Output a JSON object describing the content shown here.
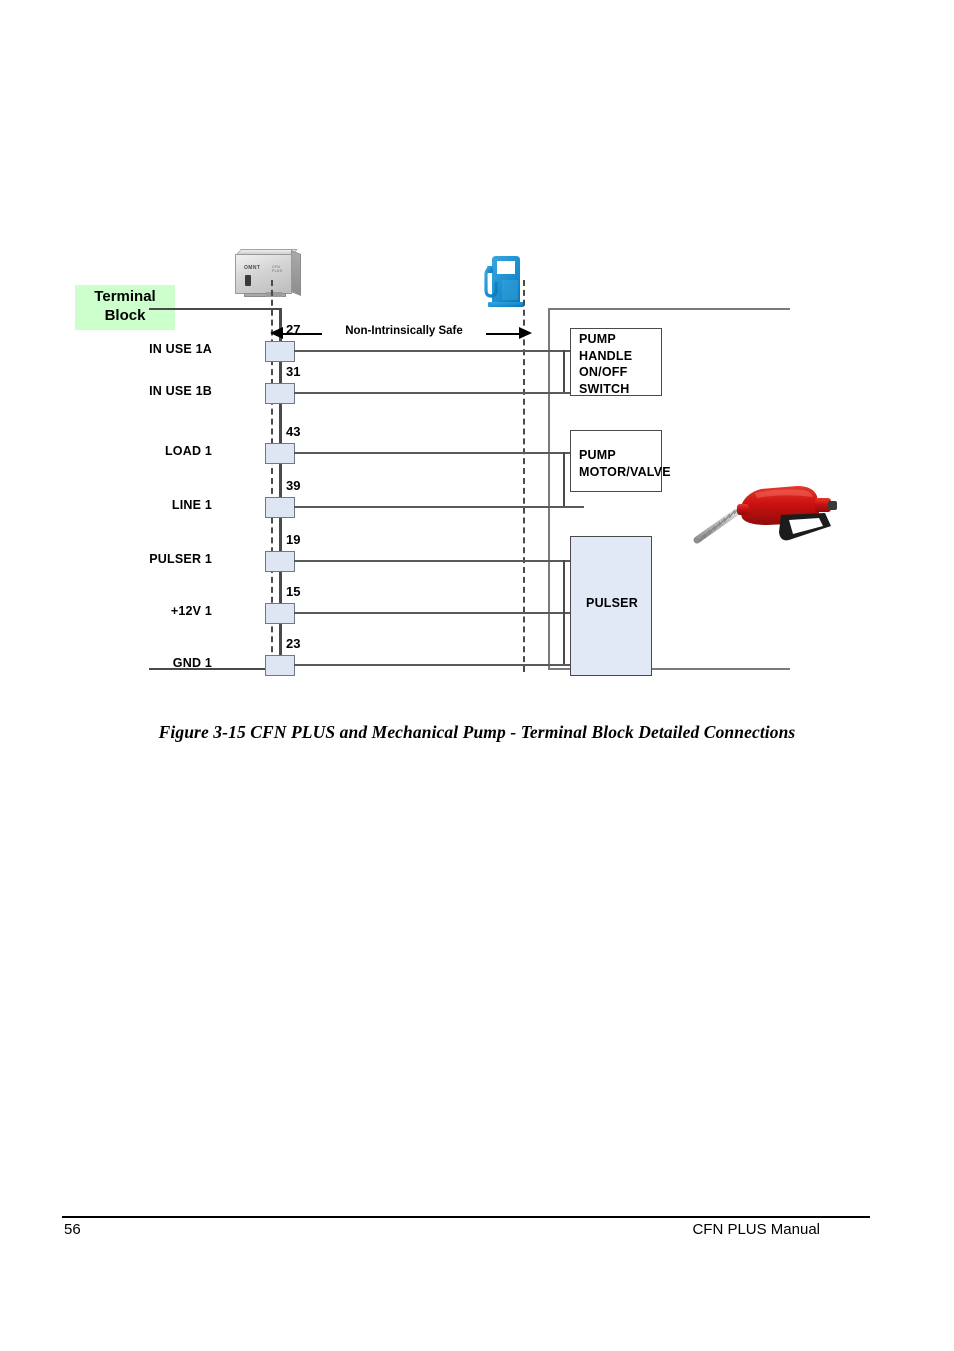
{
  "page": {
    "footer_page_number": "56",
    "footer_title": "CFN PLUS Manual"
  },
  "figure": {
    "caption": "Figure 3-15  CFN PLUS and Mechanical Pump - Terminal Block Detailed Connections",
    "terminal_block": {
      "label_line1": "Terminal",
      "label_line2": "Block",
      "highlight_color": "#ccffcc"
    },
    "zone_label": {
      "text": "Non-Intrinsically Safe",
      "arrow": "double-headed"
    },
    "terminals": [
      {
        "label": "IN USE 1A",
        "number": "27"
      },
      {
        "label": "IN USE 1B",
        "number": "31"
      },
      {
        "label": "LOAD 1",
        "number": "43"
      },
      {
        "label": "LINE 1",
        "number": "39"
      },
      {
        "label": "PULSER 1",
        "number": "19"
      },
      {
        "label": "+12V 1",
        "number": "15"
      },
      {
        "label": "GND 1",
        "number": "23"
      }
    ],
    "components": [
      {
        "id": "switch",
        "lines": [
          "PUMP",
          "HANDLE",
          "ON/OFF",
          "SWITCH"
        ]
      },
      {
        "id": "motor",
        "lines": [
          "PUMP",
          "MOTOR/VALVE"
        ]
      },
      {
        "id": "pulser",
        "lines": [
          "PULSER"
        ]
      }
    ],
    "controller": {
      "logo_text": "OMNT",
      "model_text": "CFN PLUS"
    },
    "icons": {
      "dispenser_color": "#1a8fd1",
      "nozzle_color": "#cc1111"
    }
  }
}
